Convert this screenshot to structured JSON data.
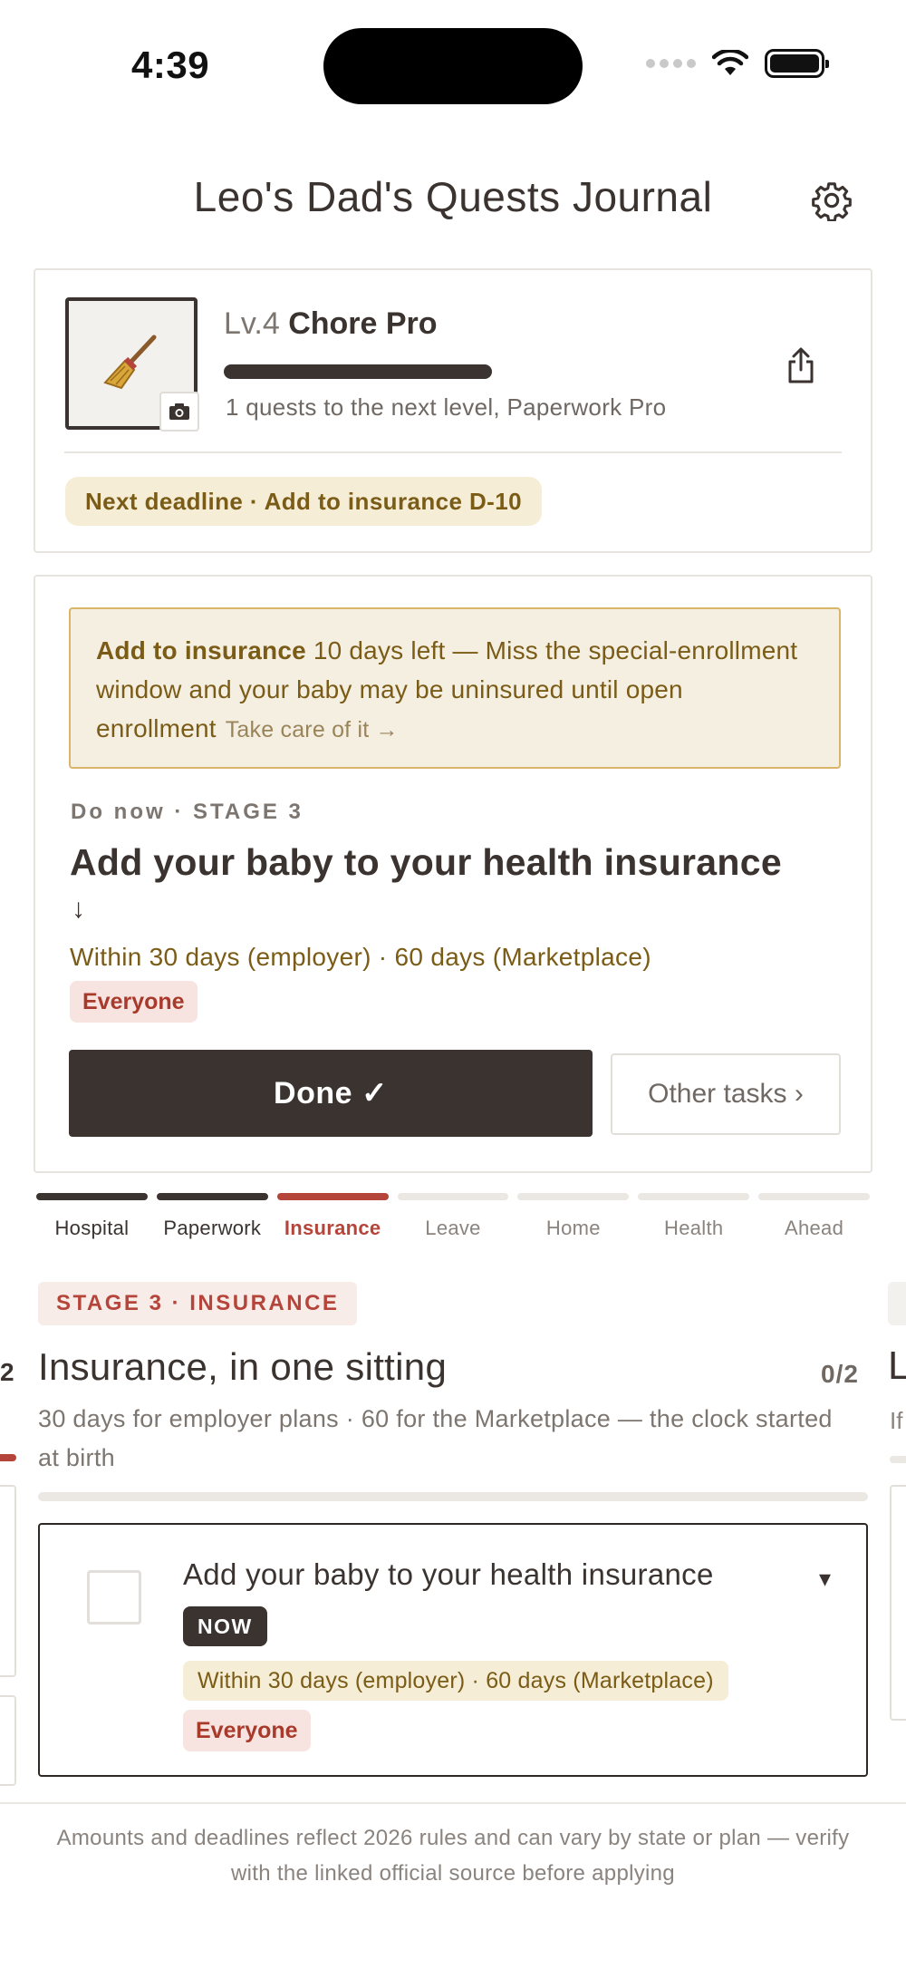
{
  "status_bar": {
    "time": "4:39"
  },
  "header": {
    "title": "Leo's Dad's Quests Journal",
    "settings_icon": "gear-icon"
  },
  "profile": {
    "avatar_icon": "broom-icon",
    "camera_icon": "camera-icon",
    "level_prefix": "Lv.4",
    "level_name": "Chore Pro",
    "xp_progress": 1.0,
    "next_level_hint": "1 quests to the next level, Paperwork Pro",
    "share_icon": "share-icon",
    "next_deadline": "Next deadline · Add to insurance D-10"
  },
  "current_task": {
    "alert": {
      "strong": "Add to insurance",
      "text": " 10 days left — Miss the special-enrollment window and your baby may be uninsured until open enrollment",
      "link": "Take care of it →"
    },
    "eyebrow": "Do now · STAGE 3",
    "title": "Add your baby to your health insurance",
    "arrow": "↓",
    "window": "Within 30 days (employer) · 60 days (Marketplace)",
    "audience": "Everyone",
    "done_label": "Done ✓",
    "other_label": "Other tasks ›"
  },
  "stages": [
    {
      "label": "Hospital",
      "state": "done"
    },
    {
      "label": "Paperwork",
      "state": "done"
    },
    {
      "label": "Insurance",
      "state": "active"
    },
    {
      "label": "Leave",
      "state": "upcoming"
    },
    {
      "label": "Home",
      "state": "upcoming"
    },
    {
      "label": "Health",
      "state": "upcoming"
    },
    {
      "label": "Ahead",
      "state": "upcoming"
    }
  ],
  "stage_section": {
    "badge": "STAGE 3 · INSURANCE",
    "title": "Insurance, in one sitting",
    "count": "0/2",
    "subtitle": "30 days for employer plans · 60 for the Marketplace — the clock started at birth",
    "progress": 0,
    "peek_left_count": "2",
    "peek_right_title": "L",
    "peek_right_sub": "If",
    "quest": {
      "title": "Add your baby to your health insurance",
      "caret": "▾",
      "badge": "NOW",
      "window": "Within 30 days (employer) · 60 days (Marketplace)",
      "audience": "Everyone",
      "checked": false
    }
  },
  "footer": {
    "disclaimer": "Amounts and deadlines reflect 2026 rules and can vary by state or plan — verify with the linked official source before applying"
  },
  "colors": {
    "ink": "#3a3330",
    "accent_red": "#b5453a",
    "warning_bg": "#f5efe2",
    "warning_border": "#d9b56a",
    "warning_text": "#7a5c17"
  }
}
